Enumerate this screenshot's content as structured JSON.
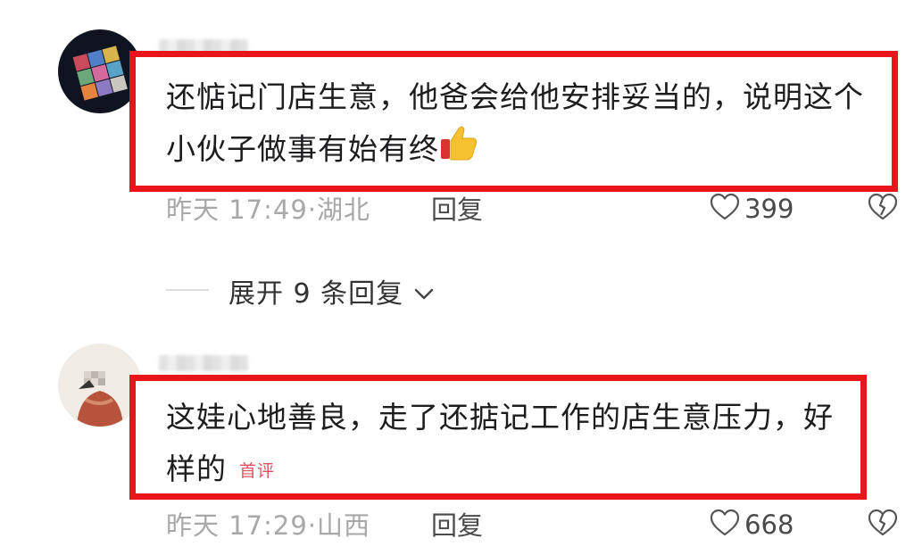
{
  "comments": [
    {
      "text": "还惦记门店生意，他爸会给他安排妥当的，说明这个小伙子做事有始有终",
      "emoji": "thumbs-up",
      "time": "昨天 17:49",
      "location": "湖北",
      "reply_label": "回复",
      "likes": "399"
    },
    {
      "text": "这娃心地善良，走了还掂记工作的店生意压力，好样的",
      "badge": "首评",
      "time": "昨天 17:29",
      "location": "山西",
      "reply_label": "回复",
      "likes": "668"
    }
  ],
  "expand": {
    "label": "展开 9 条回复"
  },
  "colors": {
    "highlight_border": "#e8151b",
    "meta_gray": "#a8a8a8",
    "badge_red": "#e05462"
  },
  "icons": [
    "heart-outline-icon",
    "broken-heart-icon",
    "chevron-down-icon",
    "thumbs-up-icon"
  ]
}
